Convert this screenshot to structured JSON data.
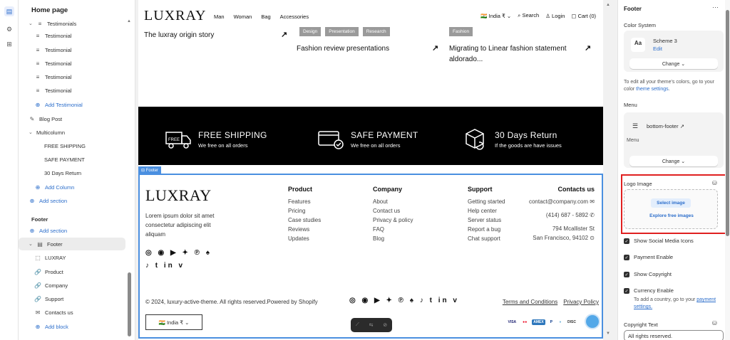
{
  "rail": {
    "icons": [
      "layout-icon",
      "gear-icon",
      "apps-icon"
    ]
  },
  "tree": {
    "page_title": "Home page",
    "rows": [
      {
        "label": "Testimonials",
        "icon": "≡",
        "icon_name": "list-icon",
        "prefix": "⌄",
        "kind": "group"
      },
      {
        "label": "Testimonial",
        "icon": "≡",
        "icon_name": "list-icon"
      },
      {
        "label": "Testimonial",
        "icon": "≡",
        "icon_name": "list-icon"
      },
      {
        "label": "Testimonial",
        "icon": "≡",
        "icon_name": "list-icon"
      },
      {
        "label": "Testimonial",
        "icon": "≡",
        "icon_name": "list-icon"
      },
      {
        "label": "Testimonial",
        "icon": "≡",
        "icon_name": "list-icon"
      },
      {
        "label": "Add Testimonial",
        "icon": "⊕",
        "icon_name": "add-icon",
        "kind": "add"
      },
      {
        "label": "Blog Post",
        "icon": "✎",
        "icon_name": "blog-icon"
      },
      {
        "label": "Multicolumn",
        "icon": "",
        "icon_name": "",
        "prefix": "⌄",
        "kind": "group"
      },
      {
        "label": "FREE SHIPPING",
        "icon": "",
        "icon_name": ""
      },
      {
        "label": "SAFE PAYMENT",
        "icon": "",
        "icon_name": ""
      },
      {
        "label": "30 Days Return",
        "icon": "",
        "icon_name": ""
      },
      {
        "label": "Add Column",
        "icon": "⊕",
        "icon_name": "add-icon",
        "kind": "add"
      },
      {
        "label": "Add section",
        "icon": "⊕",
        "icon_name": "add-icon",
        "kind": "add"
      },
      {
        "label": "Footer",
        "icon": "",
        "icon_name": "",
        "kind": "header"
      },
      {
        "label": "Add section",
        "icon": "⊕",
        "icon_name": "add-icon",
        "kind": "add"
      },
      {
        "label": "Footer",
        "icon": "▤",
        "icon_name": "footer-icon",
        "prefix": "⌄",
        "kind": "selected"
      },
      {
        "label": "LUXRAY",
        "icon": "⬚",
        "icon_name": "logo-block-icon"
      },
      {
        "label": "Product",
        "icon": "🔗",
        "icon_name": "link-icon"
      },
      {
        "label": "Company",
        "icon": "🔗",
        "icon_name": "link-icon"
      },
      {
        "label": "Support",
        "icon": "🔗",
        "icon_name": "link-icon"
      },
      {
        "label": "Contacts us",
        "icon": "✉",
        "icon_name": "mail-icon"
      },
      {
        "label": "Add block",
        "icon": "⊕",
        "icon_name": "add-icon",
        "kind": "add"
      }
    ]
  },
  "preview": {
    "logo": "LUXRAY",
    "nav_links": [
      "Man",
      "Woman",
      "Bag",
      "Accessories"
    ],
    "nav_right": {
      "country": "🇮🇳 India ₹ ⌄",
      "search": "⌕ Search",
      "login": "♙ Login",
      "cart": "▢ Cart (0)"
    },
    "story_title": "The luxray origin story",
    "article1": {
      "tags": [
        "Design",
        "Presentation",
        "Research"
      ],
      "title": "Fashion review presentations"
    },
    "article2": {
      "tags": [
        "Fashion"
      ],
      "title": "Migrating to Linear fashion statement aldorado..."
    },
    "arrow": "↗",
    "features": [
      {
        "title": "FREE SHIPPING",
        "subtitle": "We free on all orders"
      },
      {
        "title": "SAFE PAYMENT",
        "subtitle": "We free on all orders"
      },
      {
        "title": "30 Days Return",
        "subtitle": "If the goods are have issues"
      }
    ],
    "footer_badge": "⊟ Footer",
    "footer": {
      "logo": "LUXRAY",
      "description": "Lorem ipsum dolor sit amet consectetur adipiscing elit aliquam",
      "socials_row1": "◎ ◉ ▶ ✦ ℗ ♠",
      "socials_row2": "♪ t in v",
      "columns": [
        {
          "heading": "Product",
          "links": [
            "Features",
            "Pricing",
            "Case studies",
            "Reviews",
            "Updates"
          ]
        },
        {
          "heading": "Company",
          "links": [
            "About",
            "Contact us",
            "Privacy & policy",
            "FAQ",
            "Blog"
          ]
        },
        {
          "heading": "Support",
          "links": [
            "Getting started",
            "Help center",
            "Server status",
            "Report a bug",
            "Chat support"
          ]
        }
      ],
      "contact": {
        "heading": "Contacts us",
        "email": "contact@company.com ✉",
        "phone": "(414) 687 - 5892 ✆",
        "address1": "794 Mcallister St",
        "address2": "San Francisco, 94102 ⊙"
      },
      "copyright": "© 2024, luxury-active-theme. All rights reserved.Powered by Shopify",
      "socials_inline": "◎ ◉ ▶ ✦ ℗ ♠ ♪ t in v",
      "policies": [
        "Terms and Conditions",
        "Privacy Policy"
      ],
      "country_select": "🇮🇳 India ₹ ⌄",
      "payments": [
        {
          "label": "VISA",
          "color": "#1a1f71",
          "bg": "#ffffff"
        },
        {
          "label": "●●",
          "color": "#eb001b",
          "bg": "#ffffff"
        },
        {
          "label": "AMEX",
          "color": "#ffffff",
          "bg": "#2e77bc"
        },
        {
          "label": "P",
          "color": "#003087",
          "bg": "#ffffff"
        },
        {
          "label": "◑",
          "color": "#0079be",
          "bg": "#ffffff"
        },
        {
          "label": "DISC",
          "color": "#333333",
          "bg": "#ffffff"
        }
      ],
      "floatbar_icons": [
        "⟋",
        "⇆",
        "⊘"
      ]
    }
  },
  "settings": {
    "title": "Footer",
    "more": "···",
    "color_system_label": "Color System",
    "scheme_name": "Scheme 3",
    "scheme_edit": "Edit",
    "scheme_swatch": "Aa",
    "change_label": "Change ⌄",
    "color_help_prefix": "To edit all your theme's colors, go to your color ",
    "color_help_link": "theme settings",
    "color_help_suffix": ".",
    "menu_label": "Menu",
    "menu_name": "bottom-footer ↗",
    "menu_sub": "Menu",
    "menu_change_label": "Change ⌄",
    "logo_image_label": "Logo Image",
    "select_image": "Select image",
    "explore_images": "Explore free images",
    "checks": [
      {
        "label": "Show Social Media Icons"
      },
      {
        "label": "Payment Enable"
      },
      {
        "label": "Show Copyright"
      },
      {
        "label": "Currency Enable"
      }
    ],
    "currency_help_prefix": "To add a country, go to your ",
    "currency_help_link": "payment settings.",
    "copyright_text_label": "Copyright Text",
    "copyright_text_value": "All rights reserved.",
    "accent_color": "#2c6ecb",
    "highlight_color": "#e02020"
  }
}
